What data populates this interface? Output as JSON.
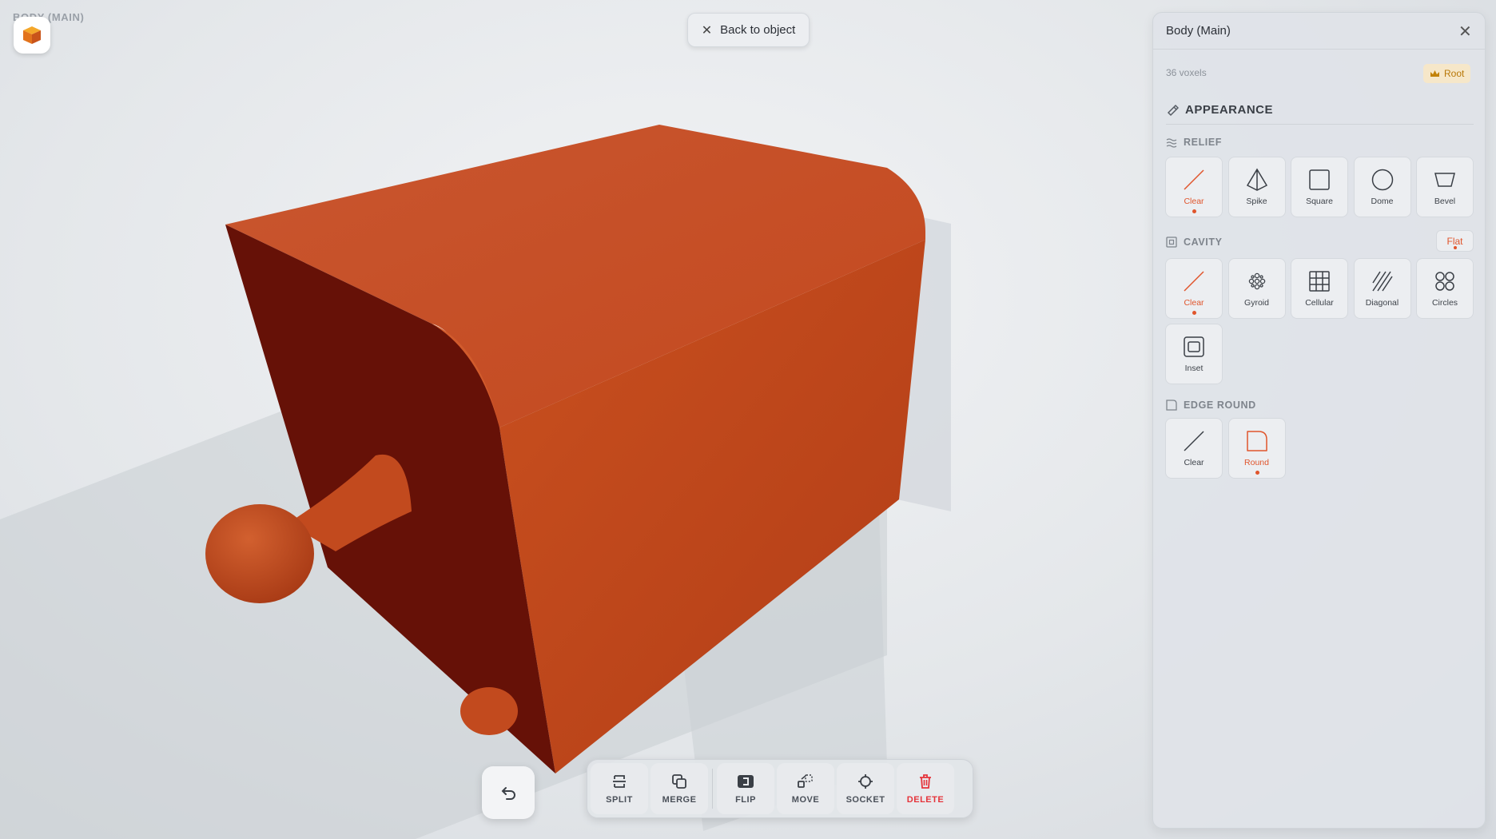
{
  "breadcrumb": "BODY (MAIN)",
  "back_button": {
    "label": "Back to object"
  },
  "toolbar": {
    "undo_icon": "undo-icon",
    "tools": [
      {
        "label": "SPLIT",
        "icon": "split-icon"
      },
      {
        "label": "MERGE",
        "icon": "merge-icon"
      },
      {
        "label": "FLIP",
        "icon": "flip-icon"
      },
      {
        "label": "MOVE",
        "icon": "move-icon"
      },
      {
        "label": "SOCKET",
        "icon": "socket-icon"
      },
      {
        "label": "DELETE",
        "icon": "trash-icon"
      }
    ]
  },
  "panel": {
    "title": "Body (Main)",
    "voxels": "36 voxels",
    "root_badge": "Root",
    "appearance_label": "APPEARANCE",
    "relief": {
      "label": "RELIEF",
      "options": [
        {
          "label": "Clear",
          "selected": true
        },
        {
          "label": "Spike"
        },
        {
          "label": "Square"
        },
        {
          "label": "Dome"
        },
        {
          "label": "Bevel"
        }
      ]
    },
    "cavity": {
      "label": "CAVITY",
      "mode": "Flat",
      "options": [
        {
          "label": "Clear",
          "selected": true
        },
        {
          "label": "Gyroid"
        },
        {
          "label": "Cellular"
        },
        {
          "label": "Diagonal"
        },
        {
          "label": "Circles"
        },
        {
          "label": "Inset"
        }
      ]
    },
    "edge_round": {
      "label": "EDGE ROUND",
      "options": [
        {
          "label": "Clear"
        },
        {
          "label": "Round",
          "selected": true
        }
      ]
    }
  },
  "colors": {
    "accent": "#e0552c",
    "object": "#c94a22",
    "danger": "#e5343b",
    "root": "#b87808"
  }
}
